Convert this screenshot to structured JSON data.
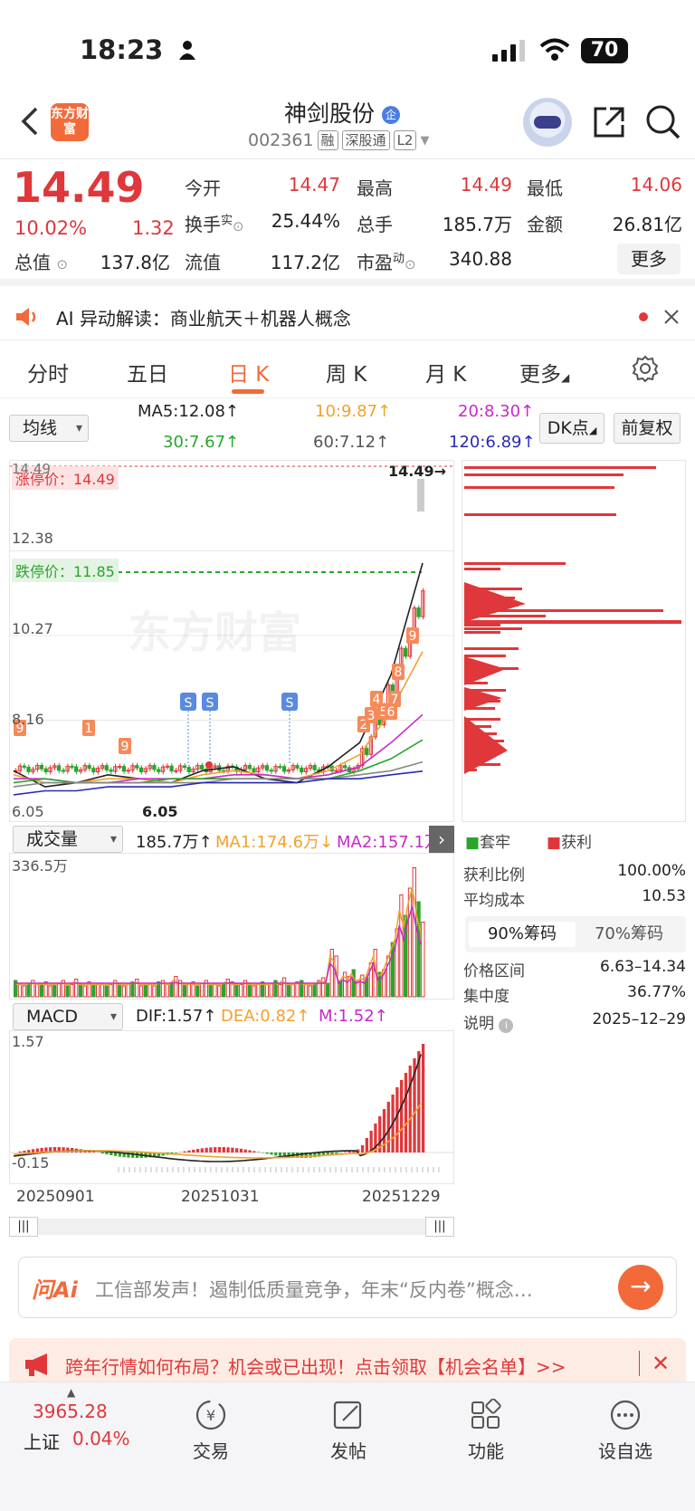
{
  "status_bar": {
    "time": "18:23",
    "battery": "70"
  },
  "header": {
    "logo": "东方财富",
    "stock_name": "神剑股份",
    "stock_code": "002361",
    "tags": [
      "融",
      "深股通",
      "L2"
    ]
  },
  "quote": {
    "price": "14.49",
    "pct": "10.02%",
    "change": "1.32",
    "rows": [
      [
        {
          "label": "今开",
          "value": "14.47",
          "color": "red"
        },
        {
          "label": "最高",
          "value": "14.49",
          "color": "red"
        },
        {
          "label": "最低",
          "value": "14.06",
          "color": "red"
        }
      ],
      [
        {
          "label": "换手",
          "sup": "实",
          "value": "25.44%",
          "color": "black"
        },
        {
          "label": "总手",
          "value": "185.7万",
          "color": "black"
        },
        {
          "label": "金额",
          "value": "26.81亿",
          "color": "black"
        }
      ],
      [
        {
          "label": "总值",
          "value": "137.8亿",
          "color": "black"
        },
        {
          "label": "流值",
          "value": "117.2亿",
          "color": "black"
        },
        {
          "label": "市盈",
          "sup": "动",
          "value": "340.88",
          "color": "black"
        }
      ]
    ],
    "more": "更多"
  },
  "ai_bar": {
    "text": "AI 异动解读：商业航天＋机器人概念"
  },
  "tabs": [
    "分时",
    "五日",
    "日 K",
    "周 K",
    "月 K",
    "更多"
  ],
  "active_tab": "日 K",
  "ma": {
    "selector": "均线",
    "ma5": "MA5:12.08↑",
    "ma10": "10:9.87↑",
    "ma20": "20:8.30↑",
    "ma30": "30:7.67↑",
    "ma60": "60:7.12↑",
    "ma120": "120:6.89↑",
    "dk": "DK点",
    "adjust": "前复权"
  },
  "kline": {
    "limit_up_label": "涨停价：14.49",
    "limit_down_label": "跌停价：11.85",
    "top_price_label": "14.49",
    "last_price_label": "14.49→",
    "y_labels": [
      "12.38",
      "10.27",
      "8.16",
      "6.05"
    ],
    "low_label": "6.05",
    "watermark": "东方财富",
    "signal_numbers": [
      "9",
      "4",
      "7",
      "8",
      "9",
      "1",
      "2",
      "3",
      "5",
      "6"
    ],
    "signal_letter": "S"
  },
  "chart_data": {
    "type": "line",
    "title": "",
    "x": [
      "20250901",
      "20251031",
      "20251229"
    ],
    "ylim": [
      6.05,
      14.49
    ],
    "series": [
      {
        "name": "MA5",
        "values": [
          6.9,
          6.5,
          6.6,
          6.8,
          6.7,
          6.6,
          6.9,
          7.0,
          6.7,
          6.6,
          7.0,
          7.6,
          9.3,
          12.08
        ]
      },
      {
        "name": "MA10",
        "values": [
          6.8,
          6.6,
          6.6,
          6.7,
          6.7,
          6.6,
          6.8,
          6.9,
          6.8,
          6.7,
          6.9,
          7.3,
          8.4,
          9.87
        ]
      },
      {
        "name": "MA20",
        "values": [
          6.7,
          6.7,
          6.6,
          6.6,
          6.7,
          6.7,
          6.7,
          6.8,
          6.8,
          6.7,
          6.8,
          7.0,
          7.6,
          8.3
        ]
      },
      {
        "name": "MA30",
        "values": [
          6.6,
          6.7,
          6.6,
          6.6,
          6.6,
          6.7,
          6.7,
          6.7,
          6.7,
          6.7,
          6.7,
          6.9,
          7.2,
          7.67
        ]
      },
      {
        "name": "MA60",
        "values": [
          6.5,
          6.6,
          6.6,
          6.6,
          6.6,
          6.6,
          6.6,
          6.7,
          6.7,
          6.7,
          6.7,
          6.8,
          6.9,
          7.12
        ]
      },
      {
        "name": "MA120",
        "values": [
          6.3,
          6.4,
          6.4,
          6.5,
          6.5,
          6.5,
          6.6,
          6.6,
          6.6,
          6.6,
          6.7,
          6.7,
          6.8,
          6.89
        ]
      }
    ]
  },
  "volume": {
    "selector": "成交量",
    "value": "185.7万↑",
    "ma1": "MA1:174.6万↓",
    "ma2": "MA2:157.1万",
    "max_label": "336.5万",
    "bars": [
      0.12,
      0.1,
      0.08,
      0.1,
      0.12,
      0.09,
      0.1,
      0.11,
      0.08,
      0.09,
      0.1,
      0.12,
      0.08,
      0.09,
      0.13,
      0.1,
      0.08,
      0.11,
      0.09,
      0.1,
      0.1,
      0.08,
      0.09,
      0.12,
      0.1,
      0.08,
      0.09,
      0.11,
      0.13,
      0.08,
      0.09,
      0.1,
      0.08,
      0.11,
      0.12,
      0.09,
      0.1,
      0.15,
      0.12,
      0.09,
      0.1,
      0.11,
      0.08,
      0.1,
      0.12,
      0.09,
      0.1,
      0.08,
      0.09,
      0.13,
      0.11,
      0.1,
      0.09,
      0.12,
      0.1,
      0.08,
      0.1,
      0.11,
      0.09,
      0.1,
      0.12,
      0.09,
      0.14,
      0.1,
      0.09,
      0.11,
      0.12,
      0.1,
      0.08,
      0.1,
      0.12,
      0.14,
      0.1,
      0.35,
      0.3,
      0.12,
      0.18,
      0.15,
      0.2,
      0.12,
      0.16,
      0.14,
      0.25,
      0.35,
      0.18,
      0.2,
      0.3,
      0.4,
      0.5,
      0.75,
      0.6,
      0.8,
      0.95,
      0.7,
      0.55
    ],
    "bar_colors": "alternating"
  },
  "macd": {
    "selector": "MACD",
    "dif": "DIF:1.57↑",
    "dea": "DEA:0.82↑",
    "m": "M:1.52↑",
    "top_label": "1.57",
    "bottom_label": "-0.15"
  },
  "dates": [
    "20250901",
    "20251031",
    "20251229"
  ],
  "chips": {
    "legend_trapped": "套牢",
    "legend_profit": "获利",
    "profit_ratio_label": "获利比例",
    "profit_ratio": "100.00%",
    "avg_cost_label": "平均成本",
    "avg_cost": "10.53",
    "tab_90": "90%筹码",
    "tab_70": "70%筹码",
    "range_label": "价格区间",
    "range": "6.63–14.34",
    "concentration_label": "集中度",
    "concentration": "36.77%",
    "note_label": "说明",
    "date": "2025–12–29"
  },
  "ask_ai": {
    "logo": "问Ai",
    "text": "工信部发声！遏制低质量竞争，年末“反内卷”概念…"
  },
  "promo": {
    "text": "跨年行情如何布局？机会或已出现！点击领取【机会名单】>>"
  },
  "bottom_nav": {
    "index_value": "3965.28",
    "index_name": "上证",
    "index_pct": "0.04%",
    "items": [
      "交易",
      "发帖",
      "功能",
      "设自选"
    ]
  },
  "colors": {
    "accent": "#f26a3a",
    "up": "#e0373a",
    "down": "#2aa52a"
  }
}
